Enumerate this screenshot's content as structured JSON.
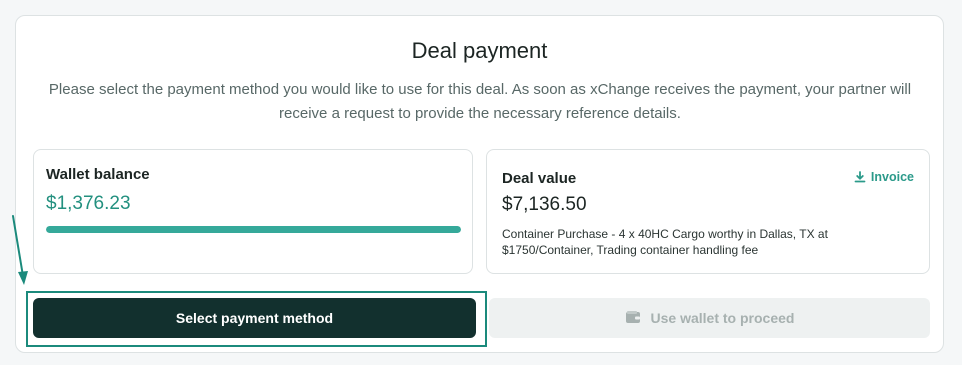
{
  "dialog": {
    "title": "Deal payment",
    "description": "Please select the payment method you would like to use for this deal. As soon as xChange receives the payment, your partner will receive a request to provide the necessary reference details."
  },
  "wallet": {
    "label": "Wallet balance",
    "amount": "$1,376.23",
    "progress_fraction": 1.0
  },
  "deal": {
    "label": "Deal value",
    "amount": "$7,136.50",
    "description": "Container Purchase - 4 x 40HC Cargo worthy in Dallas, TX at $1750/Container, Trading container handling fee",
    "invoice_label": "Invoice",
    "invoice_icon": "download-icon"
  },
  "actions": {
    "select_payment_label": "Select payment method",
    "use_wallet_label": "Use wallet to proceed",
    "use_wallet_icon": "wallet-icon"
  },
  "colors": {
    "accent": "#23907f",
    "primary_button": "#12302e",
    "annotation": "#1b8a7c"
  }
}
